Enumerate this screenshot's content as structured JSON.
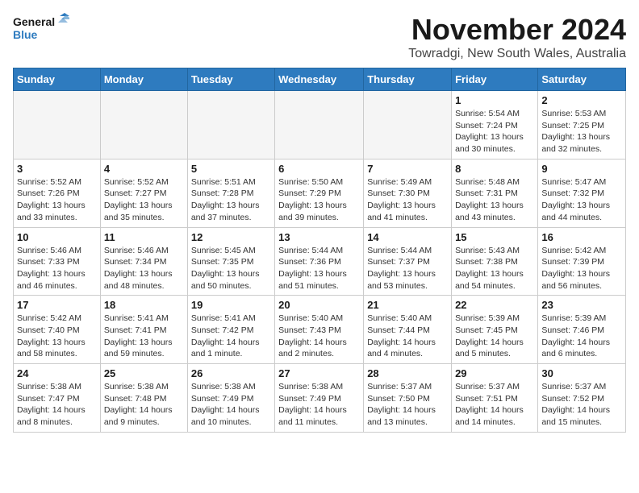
{
  "logo": {
    "line1": "General",
    "line2": "Blue"
  },
  "title": "November 2024",
  "location": "Towradgi, New South Wales, Australia",
  "weekdays": [
    "Sunday",
    "Monday",
    "Tuesday",
    "Wednesday",
    "Thursday",
    "Friday",
    "Saturday"
  ],
  "weeks": [
    [
      {
        "day": "",
        "info": ""
      },
      {
        "day": "",
        "info": ""
      },
      {
        "day": "",
        "info": ""
      },
      {
        "day": "",
        "info": ""
      },
      {
        "day": "",
        "info": ""
      },
      {
        "day": "1",
        "info": "Sunrise: 5:54 AM\nSunset: 7:24 PM\nDaylight: 13 hours\nand 30 minutes."
      },
      {
        "day": "2",
        "info": "Sunrise: 5:53 AM\nSunset: 7:25 PM\nDaylight: 13 hours\nand 32 minutes."
      }
    ],
    [
      {
        "day": "3",
        "info": "Sunrise: 5:52 AM\nSunset: 7:26 PM\nDaylight: 13 hours\nand 33 minutes."
      },
      {
        "day": "4",
        "info": "Sunrise: 5:52 AM\nSunset: 7:27 PM\nDaylight: 13 hours\nand 35 minutes."
      },
      {
        "day": "5",
        "info": "Sunrise: 5:51 AM\nSunset: 7:28 PM\nDaylight: 13 hours\nand 37 minutes."
      },
      {
        "day": "6",
        "info": "Sunrise: 5:50 AM\nSunset: 7:29 PM\nDaylight: 13 hours\nand 39 minutes."
      },
      {
        "day": "7",
        "info": "Sunrise: 5:49 AM\nSunset: 7:30 PM\nDaylight: 13 hours\nand 41 minutes."
      },
      {
        "day": "8",
        "info": "Sunrise: 5:48 AM\nSunset: 7:31 PM\nDaylight: 13 hours\nand 43 minutes."
      },
      {
        "day": "9",
        "info": "Sunrise: 5:47 AM\nSunset: 7:32 PM\nDaylight: 13 hours\nand 44 minutes."
      }
    ],
    [
      {
        "day": "10",
        "info": "Sunrise: 5:46 AM\nSunset: 7:33 PM\nDaylight: 13 hours\nand 46 minutes."
      },
      {
        "day": "11",
        "info": "Sunrise: 5:46 AM\nSunset: 7:34 PM\nDaylight: 13 hours\nand 48 minutes."
      },
      {
        "day": "12",
        "info": "Sunrise: 5:45 AM\nSunset: 7:35 PM\nDaylight: 13 hours\nand 50 minutes."
      },
      {
        "day": "13",
        "info": "Sunrise: 5:44 AM\nSunset: 7:36 PM\nDaylight: 13 hours\nand 51 minutes."
      },
      {
        "day": "14",
        "info": "Sunrise: 5:44 AM\nSunset: 7:37 PM\nDaylight: 13 hours\nand 53 minutes."
      },
      {
        "day": "15",
        "info": "Sunrise: 5:43 AM\nSunset: 7:38 PM\nDaylight: 13 hours\nand 54 minutes."
      },
      {
        "day": "16",
        "info": "Sunrise: 5:42 AM\nSunset: 7:39 PM\nDaylight: 13 hours\nand 56 minutes."
      }
    ],
    [
      {
        "day": "17",
        "info": "Sunrise: 5:42 AM\nSunset: 7:40 PM\nDaylight: 13 hours\nand 58 minutes."
      },
      {
        "day": "18",
        "info": "Sunrise: 5:41 AM\nSunset: 7:41 PM\nDaylight: 13 hours\nand 59 minutes."
      },
      {
        "day": "19",
        "info": "Sunrise: 5:41 AM\nSunset: 7:42 PM\nDaylight: 14 hours\nand 1 minute."
      },
      {
        "day": "20",
        "info": "Sunrise: 5:40 AM\nSunset: 7:43 PM\nDaylight: 14 hours\nand 2 minutes."
      },
      {
        "day": "21",
        "info": "Sunrise: 5:40 AM\nSunset: 7:44 PM\nDaylight: 14 hours\nand 4 minutes."
      },
      {
        "day": "22",
        "info": "Sunrise: 5:39 AM\nSunset: 7:45 PM\nDaylight: 14 hours\nand 5 minutes."
      },
      {
        "day": "23",
        "info": "Sunrise: 5:39 AM\nSunset: 7:46 PM\nDaylight: 14 hours\nand 6 minutes."
      }
    ],
    [
      {
        "day": "24",
        "info": "Sunrise: 5:38 AM\nSunset: 7:47 PM\nDaylight: 14 hours\nand 8 minutes."
      },
      {
        "day": "25",
        "info": "Sunrise: 5:38 AM\nSunset: 7:48 PM\nDaylight: 14 hours\nand 9 minutes."
      },
      {
        "day": "26",
        "info": "Sunrise: 5:38 AM\nSunset: 7:49 PM\nDaylight: 14 hours\nand 10 minutes."
      },
      {
        "day": "27",
        "info": "Sunrise: 5:38 AM\nSunset: 7:49 PM\nDaylight: 14 hours\nand 11 minutes."
      },
      {
        "day": "28",
        "info": "Sunrise: 5:37 AM\nSunset: 7:50 PM\nDaylight: 14 hours\nand 13 minutes."
      },
      {
        "day": "29",
        "info": "Sunrise: 5:37 AM\nSunset: 7:51 PM\nDaylight: 14 hours\nand 14 minutes."
      },
      {
        "day": "30",
        "info": "Sunrise: 5:37 AM\nSunset: 7:52 PM\nDaylight: 14 hours\nand 15 minutes."
      }
    ]
  ]
}
